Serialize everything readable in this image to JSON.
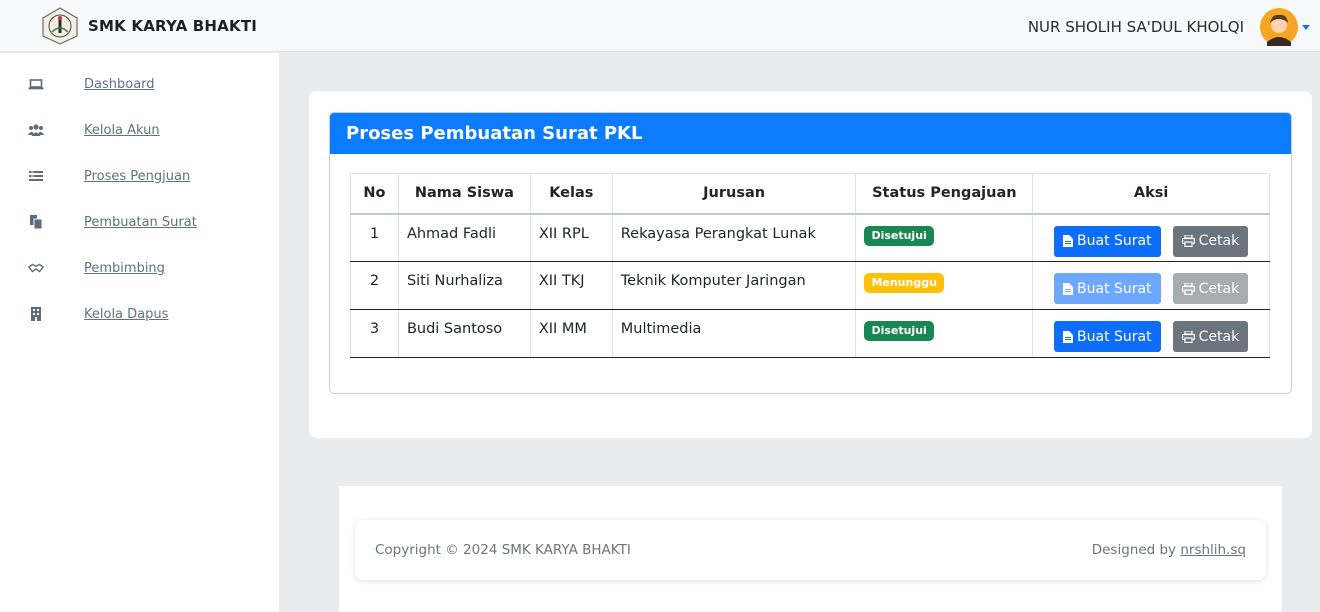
{
  "header": {
    "brand": "SMK KARYA BHAKTI",
    "user_name": "NUR SHOLIH SA'DUL KHOLQI"
  },
  "sidebar": {
    "items": [
      {
        "label": "Dashboard",
        "icon": "laptop-icon"
      },
      {
        "label": "Kelola Akun",
        "icon": "users-icon"
      },
      {
        "label": "Proses Pengjuan",
        "icon": "list-icon"
      },
      {
        "label": "Pembuatan Surat",
        "icon": "copy-icon"
      },
      {
        "label": "Pembimbing",
        "icon": "handshake-icon"
      },
      {
        "label": "Kelola Dapus",
        "icon": "building-icon"
      }
    ]
  },
  "panel": {
    "title": "Proses Pembuatan Surat PKL",
    "columns": [
      "No",
      "Nama Siswa",
      "Kelas",
      "Jurusan",
      "Status Pengajuan",
      "Aksi"
    ],
    "rows": [
      {
        "no": "1",
        "nama": "Ahmad Fadli",
        "kelas": "XII RPL",
        "jurusan": "Rekayasa Perangkat Lunak",
        "status": "Disetujui",
        "status_type": "approved",
        "actions_enabled": true
      },
      {
        "no": "2",
        "nama": "Siti Nurhaliza",
        "kelas": "XII TKJ",
        "jurusan": "Teknik Komputer Jaringan",
        "status": "Menunggu",
        "status_type": "pending",
        "actions_enabled": false
      },
      {
        "no": "3",
        "nama": "Budi Santoso",
        "kelas": "XII MM",
        "jurusan": "Multimedia",
        "status": "Disetujui",
        "status_type": "approved",
        "actions_enabled": true
      }
    ],
    "buat_label": "Buat Surat",
    "cetak_label": "Cetak"
  },
  "footer": {
    "copyright": "Copyright © 2024 SMK KARYA BHAKTI",
    "designed_prefix": "Designed by",
    "designed_link": "nrshlih.sq"
  },
  "colors": {
    "primary": "#0d6efd",
    "header_blue": "#0d7bfd",
    "approved": "#198754",
    "pending": "#ffc107",
    "secondary": "#6c757d"
  }
}
